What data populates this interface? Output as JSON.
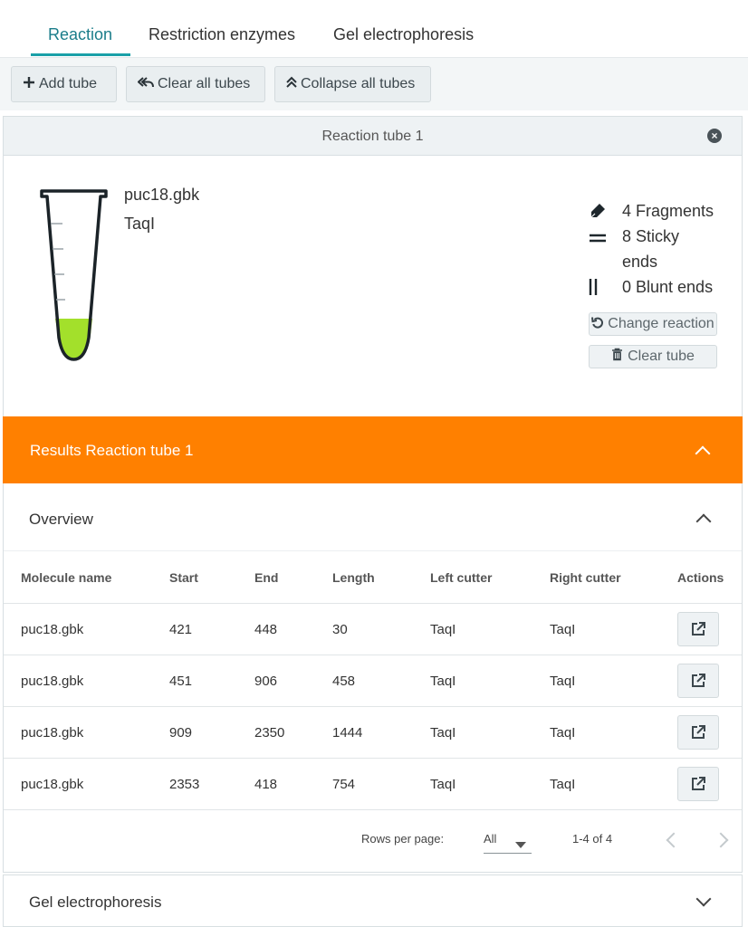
{
  "tabs": [
    {
      "label": "Reaction",
      "active": true
    },
    {
      "label": "Restriction enzymes",
      "active": false
    },
    {
      "label": "Gel electrophoresis",
      "active": false
    }
  ],
  "toolbar": {
    "add_tube": "Add tube",
    "clear_all": "Clear all tubes",
    "collapse_all": "Collapse all tubes"
  },
  "tube": {
    "title": "Reaction tube 1",
    "molecule": "puc18.gbk",
    "enzyme": "TaqI",
    "liquid_color": "#a3e02b",
    "stats": {
      "fragments": "4 Fragments",
      "sticky_line1": "8 Sticky",
      "sticky_line2": "ends",
      "blunt": "0 Blunt ends"
    },
    "change_reaction": "Change reaction",
    "clear_tube": "Clear tube"
  },
  "results": {
    "title": "Results Reaction tube 1",
    "accent_color": "#ff8000",
    "overview_title": "Overview",
    "columns": [
      "Molecule name",
      "Start",
      "End",
      "Length",
      "Left cutter",
      "Right cutter",
      "Actions"
    ],
    "rows": [
      [
        "puc18.gbk",
        "421",
        "448",
        "30",
        "TaqI",
        "TaqI"
      ],
      [
        "puc18.gbk",
        "451",
        "906",
        "458",
        "TaqI",
        "TaqI"
      ],
      [
        "puc18.gbk",
        "909",
        "2350",
        "1444",
        "TaqI",
        "TaqI"
      ],
      [
        "puc18.gbk",
        "2353",
        "418",
        "754",
        "TaqI",
        "TaqI"
      ]
    ],
    "pagination": {
      "rows_per_page_label": "Rows per page:",
      "rows_per_page_value": "All",
      "range": "1-4 of 4"
    }
  },
  "gel": {
    "title": "Gel electrophoresis"
  }
}
